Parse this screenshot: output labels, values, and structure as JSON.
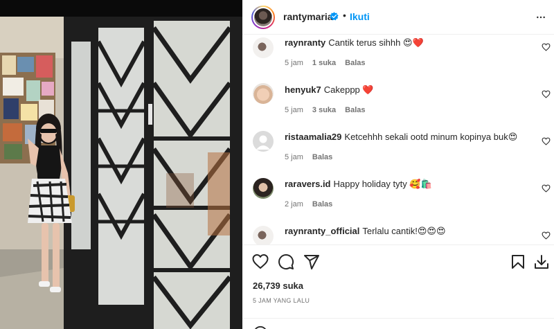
{
  "post": {
    "username": "rantymaria",
    "follow_label": "Ikuti",
    "dot": "•",
    "likes": "26,739 suka",
    "time": "5 JAM YANG LALU"
  },
  "comments": [
    {
      "user": "raynranty",
      "text": "Cantik terus sihhh 😍❤️",
      "age": "5 jam",
      "likes": "1 suka",
      "reply": "Balas"
    },
    {
      "user": "henyuk7",
      "text": "Cakeppp ❤️",
      "age": "5 jam",
      "likes": "3 suka",
      "reply": "Balas"
    },
    {
      "user": "ristaamalia29",
      "text": "Ketcehhh sekali ootd minum kopinya buk😍",
      "age": "5 jam",
      "reply": "Balas"
    },
    {
      "user": "raravers.id",
      "text": "Happy holiday tyty 🥰🛍️",
      "age": "2 jam",
      "reply": "Balas"
    },
    {
      "user": "raynranty_official",
      "text": "Terlalu cantik!😍😍😍"
    }
  ],
  "icons": {
    "verified": "verified-badge-icon",
    "more": "more-options-icon",
    "like": "heart-icon",
    "comment": "comment-bubble-icon",
    "share": "send-icon",
    "save": "bookmark-icon",
    "download": "download-icon"
  },
  "colors": {
    "accent": "#0095f6",
    "verified": "#0095f6",
    "text": "#262626",
    "muted": "#737373"
  }
}
